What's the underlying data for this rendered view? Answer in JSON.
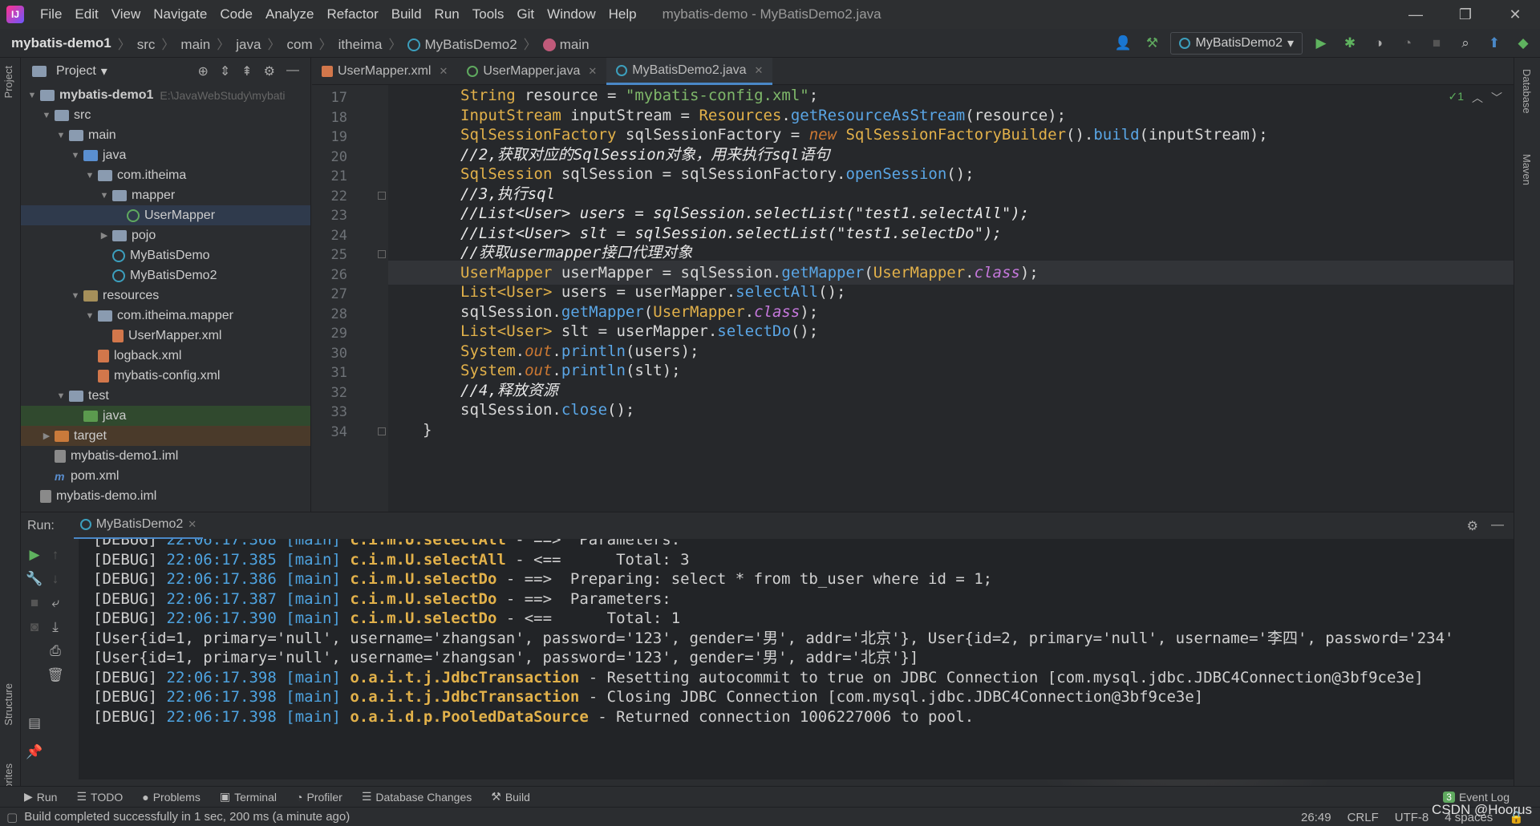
{
  "app": {
    "icon_text": "IJ",
    "window_title": "mybatis-demo - MyBatisDemo2.java"
  },
  "menu": [
    "File",
    "Edit",
    "View",
    "Navigate",
    "Code",
    "Analyze",
    "Refactor",
    "Build",
    "Run",
    "Tools",
    "Git",
    "Window",
    "Help"
  ],
  "window_controls": {
    "minimize": "—",
    "restore": "❐",
    "close": "✕"
  },
  "breadcrumb": {
    "project": "mybatis-demo1",
    "items": [
      "src",
      "main",
      "java",
      "com",
      "itheima",
      "MyBatisDemo2",
      "main"
    ]
  },
  "toolbar": {
    "run_config": "MyBatisDemo2",
    "icons": [
      "user-icon",
      "hammer-icon",
      "run-icon",
      "debug-icon",
      "coverage-icon",
      "profile-icon",
      "stop-icon",
      "search-icon",
      "update-icon",
      "jetbrains-icon"
    ]
  },
  "left_stripe": {
    "project": "Project",
    "structure": "Structure",
    "favorites": "Favorites"
  },
  "project_panel": {
    "title": "Project",
    "tree": [
      {
        "label": "mybatis-demo1",
        "extra": "E:\\JavaWebStudy\\mybati",
        "level": 0,
        "arrow": "▼",
        "type": "folder",
        "bold": true
      },
      {
        "label": "src",
        "level": 1,
        "arrow": "▼",
        "type": "folder"
      },
      {
        "label": "main",
        "level": 2,
        "arrow": "▼",
        "type": "folder"
      },
      {
        "label": "java",
        "level": 3,
        "arrow": "▼",
        "type": "folder-src"
      },
      {
        "label": "com.itheima",
        "level": 4,
        "arrow": "▼",
        "type": "folder"
      },
      {
        "label": "mapper",
        "level": 5,
        "arrow": "▼",
        "type": "folder"
      },
      {
        "label": "UserMapper",
        "level": 6,
        "arrow": "",
        "type": "interface",
        "selected": true
      },
      {
        "label": "pojo",
        "level": 5,
        "arrow": "▶",
        "type": "folder"
      },
      {
        "label": "MyBatisDemo",
        "level": 5,
        "arrow": "",
        "type": "class"
      },
      {
        "label": "MyBatisDemo2",
        "level": 5,
        "arrow": "",
        "type": "class"
      },
      {
        "label": "resources",
        "level": 3,
        "arrow": "▼",
        "type": "folder-res"
      },
      {
        "label": "com.itheima.mapper",
        "level": 4,
        "arrow": "▼",
        "type": "folder"
      },
      {
        "label": "UserMapper.xml",
        "level": 5,
        "arrow": "",
        "type": "xml"
      },
      {
        "label": "logback.xml",
        "level": 4,
        "arrow": "",
        "type": "xml"
      },
      {
        "label": "mybatis-config.xml",
        "level": 4,
        "arrow": "",
        "type": "xml"
      },
      {
        "label": "test",
        "level": 2,
        "arrow": "▼",
        "type": "folder"
      },
      {
        "label": "java",
        "level": 3,
        "arrow": "",
        "type": "folder-green",
        "green": true
      },
      {
        "label": "target",
        "level": 1,
        "arrow": "▶",
        "type": "folder-orange",
        "orange": true
      },
      {
        "label": "mybatis-demo1.iml",
        "level": 1,
        "arrow": "",
        "type": "iml"
      },
      {
        "label": "pom.xml",
        "level": 1,
        "arrow": "",
        "type": "maven"
      },
      {
        "label": "mybatis-demo.iml",
        "level": 0,
        "arrow": "",
        "type": "iml"
      }
    ]
  },
  "editor_tabs": [
    {
      "label": "UserMapper.xml",
      "type": "xml"
    },
    {
      "label": "UserMapper.java",
      "type": "interface"
    },
    {
      "label": "MyBatisDemo2.java",
      "type": "class",
      "active": true
    }
  ],
  "editor": {
    "indicator": "✓1",
    "lines": [
      {
        "n": "17",
        "tokens": [
          [
            "kt",
            "String"
          ],
          [
            "pl",
            " resource = "
          ],
          [
            "st",
            "\"mybatis-config.xml\""
          ],
          [
            "pl",
            ";"
          ]
        ]
      },
      {
        "n": "18",
        "tokens": [
          [
            "kt",
            "InputStream"
          ],
          [
            "pl",
            " inputStream = "
          ],
          [
            "kt",
            "Resources"
          ],
          [
            "pl",
            "."
          ],
          [
            "mt",
            "getResourceAsStream"
          ],
          [
            "pl",
            "(resource);"
          ]
        ]
      },
      {
        "n": "19",
        "tokens": [
          [
            "kt",
            "SqlSessionFactory"
          ],
          [
            "pl",
            " sqlSessionFactory = "
          ],
          [
            "kw",
            "new"
          ],
          [
            "pl",
            " "
          ],
          [
            "kt",
            "SqlSessionFactoryBuilder"
          ],
          [
            "pl",
            "()."
          ],
          [
            "mt",
            "build"
          ],
          [
            "pl",
            "(inputStream);"
          ]
        ]
      },
      {
        "n": "20",
        "tokens": [
          [
            "cm",
            "//2,获取对应的SqlSession对象，用来执行sql语句"
          ]
        ]
      },
      {
        "n": "21",
        "tokens": [
          [
            "kt",
            "SqlSession"
          ],
          [
            "pl",
            " sqlSession = sqlSessionFactory."
          ],
          [
            "mt",
            "openSession"
          ],
          [
            "pl",
            "();"
          ]
        ]
      },
      {
        "n": "22",
        "tokens": [
          [
            "cm",
            "//3,执行sql"
          ]
        ]
      },
      {
        "n": "23",
        "tokens": [
          [
            "cm",
            "//List<User> users = sqlSession.selectList(\"test1.selectAll\");"
          ]
        ]
      },
      {
        "n": "24",
        "tokens": [
          [
            "cm",
            "//List<User> slt = sqlSession.selectList(\"test1.selectDo\");"
          ]
        ]
      },
      {
        "n": "25",
        "tokens": [
          [
            "cm",
            "//获取usermapper接口代理对象"
          ]
        ]
      },
      {
        "n": "26",
        "tokens": [
          [
            "kt",
            "UserMapper"
          ],
          [
            "pl",
            " userMapper = sqlSession."
          ],
          [
            "mt",
            "getMapper"
          ],
          [
            "pl",
            "("
          ],
          [
            "kt",
            "UserMapper"
          ],
          [
            "pl",
            "."
          ],
          [
            "cl",
            "class"
          ],
          [
            "pl",
            ");"
          ]
        ],
        "current": true
      },
      {
        "n": "27",
        "tokens": [
          [
            "kt",
            "List<User>"
          ],
          [
            "pl",
            " users = userMapper."
          ],
          [
            "mt",
            "selectAll"
          ],
          [
            "pl",
            "();"
          ]
        ]
      },
      {
        "n": "28",
        "tokens": [
          [
            "pl",
            "sqlSession."
          ],
          [
            "mt",
            "getMapper"
          ],
          [
            "pl",
            "("
          ],
          [
            "kt",
            "UserMapper"
          ],
          [
            "pl",
            "."
          ],
          [
            "cl",
            "class"
          ],
          [
            "pl",
            ");"
          ]
        ]
      },
      {
        "n": "29",
        "tokens": [
          [
            "kt",
            "List<User>"
          ],
          [
            "pl",
            " slt = userMapper."
          ],
          [
            "mt",
            "selectDo"
          ],
          [
            "pl",
            "();"
          ]
        ]
      },
      {
        "n": "30",
        "tokens": [
          [
            "kt",
            "System"
          ],
          [
            "pl",
            "."
          ],
          [
            "kw",
            "out"
          ],
          [
            "pl",
            "."
          ],
          [
            "mt",
            "println"
          ],
          [
            "pl",
            "(users);"
          ]
        ]
      },
      {
        "n": "31",
        "tokens": [
          [
            "kt",
            "System"
          ],
          [
            "pl",
            "."
          ],
          [
            "kw",
            "out"
          ],
          [
            "pl",
            "."
          ],
          [
            "mt",
            "println"
          ],
          [
            "pl",
            "(slt);"
          ]
        ]
      },
      {
        "n": "32",
        "tokens": [
          [
            "cm",
            "//4,释放资源"
          ]
        ]
      },
      {
        "n": "33",
        "tokens": [
          [
            "pl",
            "sqlSession."
          ],
          [
            "mt",
            "close"
          ],
          [
            "pl",
            "();"
          ]
        ]
      },
      {
        "n": "34",
        "tokens": [
          [
            "pl",
            "}"
          ]
        ],
        "outdent": true
      }
    ]
  },
  "right_stripe": {
    "database": "Database",
    "maven": "Maven"
  },
  "run_panel": {
    "label": "Run:",
    "tab": "MyBatisDemo2",
    "console": [
      {
        "level": "[DEBUG]",
        "time": "22:06:17.368",
        "thread": "[main]",
        "logger": "c.i.m.U.selectAll",
        "msg": " - ==>  Parameters: "
      },
      {
        "level": "[DEBUG]",
        "time": "22:06:17.385",
        "thread": "[main]",
        "logger": "c.i.m.U.selectAll",
        "msg": " - <==      Total: 3"
      },
      {
        "level": "[DEBUG]",
        "time": "22:06:17.386",
        "thread": "[main]",
        "logger": "c.i.m.U.selectDo",
        "msg": " - ==>  Preparing: select * from tb_user where id = 1;"
      },
      {
        "level": "[DEBUG]",
        "time": "22:06:17.387",
        "thread": "[main]",
        "logger": "c.i.m.U.selectDo",
        "msg": " - ==>  Parameters: "
      },
      {
        "level": "[DEBUG]",
        "time": "22:06:17.390",
        "thread": "[main]",
        "logger": "c.i.m.U.selectDo",
        "msg": " - <==      Total: 1"
      },
      {
        "plain": "[User{id=1, primary='null', username='zhangsan', password='123', gender='男', addr='北京'}, User{id=2, primary='null', username='李四', password='234'"
      },
      {
        "plain": "[User{id=1, primary='null', username='zhangsan', password='123', gender='男', addr='北京'}]"
      },
      {
        "level": "[DEBUG]",
        "time": "22:06:17.398",
        "thread": "[main]",
        "logger": "o.a.i.t.j.JdbcTransaction",
        "msg": " - Resetting autocommit to true on JDBC Connection [com.mysql.jdbc.JDBC4Connection@3bf9ce3e]"
      },
      {
        "level": "[DEBUG]",
        "time": "22:06:17.398",
        "thread": "[main]",
        "logger": "o.a.i.t.j.JdbcTransaction",
        "msg": " - Closing JDBC Connection [com.mysql.jdbc.JDBC4Connection@3bf9ce3e]"
      },
      {
        "level": "[DEBUG]",
        "time": "22:06:17.398",
        "thread": "[main]",
        "logger": "o.a.i.d.p.PooledDataSource",
        "msg": " - Returned connection 1006227006 to pool."
      }
    ]
  },
  "bottom_tools": [
    {
      "label": "Run",
      "icon": "▶"
    },
    {
      "label": "TODO",
      "icon": "☰"
    },
    {
      "label": "Problems",
      "icon": "●"
    },
    {
      "label": "Terminal",
      "icon": "▣"
    },
    {
      "label": "Profiler",
      "icon": "◔"
    },
    {
      "label": "Database Changes",
      "icon": "☰"
    },
    {
      "label": "Build",
      "icon": "⚒"
    }
  ],
  "event_log": {
    "badge": "3",
    "label": "Event Log"
  },
  "status": {
    "message": "Build completed successfully in 1 sec, 200 ms (a minute ago)",
    "position": "26:49",
    "line_sep": "CRLF",
    "encoding": "UTF-8",
    "indent": "4 spaces"
  },
  "watermark": "CSDN @Hoorus",
  "colors": {
    "accent": "#4a88c7",
    "keyword_type": "#e2b14a",
    "string": "#7fb86a",
    "method": "#5aa6e6",
    "keyword": "#cc7832"
  }
}
